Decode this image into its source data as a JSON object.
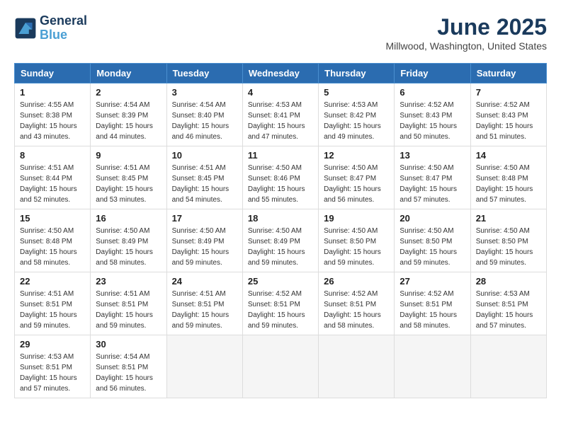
{
  "header": {
    "logo_line1": "General",
    "logo_line2": "Blue",
    "month": "June 2025",
    "location": "Millwood, Washington, United States"
  },
  "weekdays": [
    "Sunday",
    "Monday",
    "Tuesday",
    "Wednesday",
    "Thursday",
    "Friday",
    "Saturday"
  ],
  "weeks": [
    [
      {
        "day": "1",
        "sunrise": "4:55 AM",
        "sunset": "8:38 PM",
        "daylight": "15 hours and 43 minutes."
      },
      {
        "day": "2",
        "sunrise": "4:54 AM",
        "sunset": "8:39 PM",
        "daylight": "15 hours and 44 minutes."
      },
      {
        "day": "3",
        "sunrise": "4:54 AM",
        "sunset": "8:40 PM",
        "daylight": "15 hours and 46 minutes."
      },
      {
        "day": "4",
        "sunrise": "4:53 AM",
        "sunset": "8:41 PM",
        "daylight": "15 hours and 47 minutes."
      },
      {
        "day": "5",
        "sunrise": "4:53 AM",
        "sunset": "8:42 PM",
        "daylight": "15 hours and 49 minutes."
      },
      {
        "day": "6",
        "sunrise": "4:52 AM",
        "sunset": "8:43 PM",
        "daylight": "15 hours and 50 minutes."
      },
      {
        "day": "7",
        "sunrise": "4:52 AM",
        "sunset": "8:43 PM",
        "daylight": "15 hours and 51 minutes."
      }
    ],
    [
      {
        "day": "8",
        "sunrise": "4:51 AM",
        "sunset": "8:44 PM",
        "daylight": "15 hours and 52 minutes."
      },
      {
        "day": "9",
        "sunrise": "4:51 AM",
        "sunset": "8:45 PM",
        "daylight": "15 hours and 53 minutes."
      },
      {
        "day": "10",
        "sunrise": "4:51 AM",
        "sunset": "8:45 PM",
        "daylight": "15 hours and 54 minutes."
      },
      {
        "day": "11",
        "sunrise": "4:50 AM",
        "sunset": "8:46 PM",
        "daylight": "15 hours and 55 minutes."
      },
      {
        "day": "12",
        "sunrise": "4:50 AM",
        "sunset": "8:47 PM",
        "daylight": "15 hours and 56 minutes."
      },
      {
        "day": "13",
        "sunrise": "4:50 AM",
        "sunset": "8:47 PM",
        "daylight": "15 hours and 57 minutes."
      },
      {
        "day": "14",
        "sunrise": "4:50 AM",
        "sunset": "8:48 PM",
        "daylight": "15 hours and 57 minutes."
      }
    ],
    [
      {
        "day": "15",
        "sunrise": "4:50 AM",
        "sunset": "8:48 PM",
        "daylight": "15 hours and 58 minutes."
      },
      {
        "day": "16",
        "sunrise": "4:50 AM",
        "sunset": "8:49 PM",
        "daylight": "15 hours and 58 minutes."
      },
      {
        "day": "17",
        "sunrise": "4:50 AM",
        "sunset": "8:49 PM",
        "daylight": "15 hours and 59 minutes."
      },
      {
        "day": "18",
        "sunrise": "4:50 AM",
        "sunset": "8:49 PM",
        "daylight": "15 hours and 59 minutes."
      },
      {
        "day": "19",
        "sunrise": "4:50 AM",
        "sunset": "8:50 PM",
        "daylight": "15 hours and 59 minutes."
      },
      {
        "day": "20",
        "sunrise": "4:50 AM",
        "sunset": "8:50 PM",
        "daylight": "15 hours and 59 minutes."
      },
      {
        "day": "21",
        "sunrise": "4:50 AM",
        "sunset": "8:50 PM",
        "daylight": "15 hours and 59 minutes."
      }
    ],
    [
      {
        "day": "22",
        "sunrise": "4:51 AM",
        "sunset": "8:51 PM",
        "daylight": "15 hours and 59 minutes."
      },
      {
        "day": "23",
        "sunrise": "4:51 AM",
        "sunset": "8:51 PM",
        "daylight": "15 hours and 59 minutes."
      },
      {
        "day": "24",
        "sunrise": "4:51 AM",
        "sunset": "8:51 PM",
        "daylight": "15 hours and 59 minutes."
      },
      {
        "day": "25",
        "sunrise": "4:52 AM",
        "sunset": "8:51 PM",
        "daylight": "15 hours and 59 minutes."
      },
      {
        "day": "26",
        "sunrise": "4:52 AM",
        "sunset": "8:51 PM",
        "daylight": "15 hours and 58 minutes."
      },
      {
        "day": "27",
        "sunrise": "4:52 AM",
        "sunset": "8:51 PM",
        "daylight": "15 hours and 58 minutes."
      },
      {
        "day": "28",
        "sunrise": "4:53 AM",
        "sunset": "8:51 PM",
        "daylight": "15 hours and 57 minutes."
      }
    ],
    [
      {
        "day": "29",
        "sunrise": "4:53 AM",
        "sunset": "8:51 PM",
        "daylight": "15 hours and 57 minutes."
      },
      {
        "day": "30",
        "sunrise": "4:54 AM",
        "sunset": "8:51 PM",
        "daylight": "15 hours and 56 minutes."
      },
      null,
      null,
      null,
      null,
      null
    ]
  ]
}
